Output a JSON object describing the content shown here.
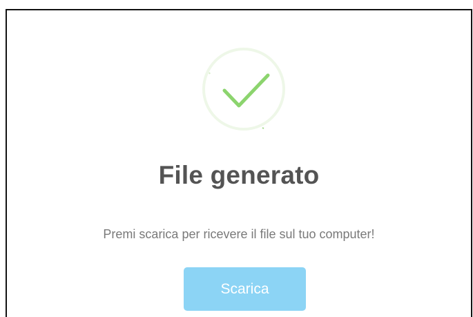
{
  "dialog": {
    "icon": "success-checkmark-icon",
    "title": "File generato",
    "message": "Premi scarica per ricevere il file sul tuo computer!",
    "confirm_label": "Scarica"
  },
  "colors": {
    "success_green": "#8cd46e",
    "success_ring": "#eef7e8",
    "title_text": "#545454",
    "message_text": "#797979",
    "button_bg": "#8cd4f5",
    "button_text": "#ffffff"
  }
}
